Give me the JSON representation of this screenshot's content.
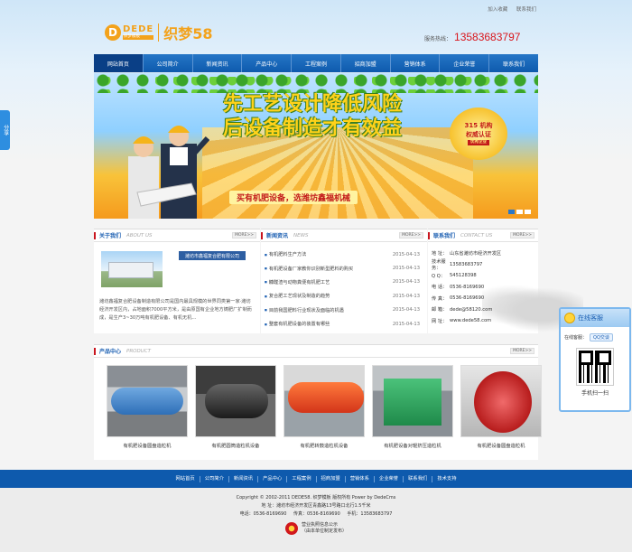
{
  "top_links": [
    "加入收藏",
    "联系我们"
  ],
  "logo": {
    "letter": "D",
    "dede": "DEDE",
    "dede_sub": "织梦模板",
    "text": "织梦58"
  },
  "hotline": {
    "label": "服务热线：",
    "number": "13583683797"
  },
  "nav": [
    {
      "label": "网站首页",
      "active": true
    },
    {
      "label": "公司简介"
    },
    {
      "label": "新闻资讯"
    },
    {
      "label": "产品中心"
    },
    {
      "label": "工程案例"
    },
    {
      "label": "招商加盟"
    },
    {
      "label": "营销体系"
    },
    {
      "label": "企业荣誉"
    },
    {
      "label": "联系我们"
    }
  ],
  "banner": {
    "line1": "先工艺设计降低风险",
    "line2": "后设备制造才有效益",
    "badge": [
      "315 机构",
      "权威认证",
      "优秀企业"
    ],
    "ribbon": "买有机肥设备，选潍坊鑫福机械"
  },
  "share": "分享",
  "about": {
    "title": "关于我们",
    "en": "ABOUT US",
    "more": "MORE>>",
    "tag": "潍坊市鑫福复合肥有限公司",
    "text": "潍坊鑫福复合肥设备制造有限公司是国内最具规模的世界同类第一家·潍坊经济开发区内，占地面积7000平方米，是由原国有企业地方铸肥厂扩制而成，是生产3~30万吨有机肥设备、有机无机..."
  },
  "news": {
    "title": "新闻资讯",
    "en": "NEWS",
    "more": "MORE>>",
    "items": [
      {
        "title": "有机肥料生产方法",
        "date": "2015-04-13"
      },
      {
        "title": "有机肥设备厂家教你识别新型肥料的购买",
        "date": "2015-04-13"
      },
      {
        "title": "糠醛渣与动物粪便有机肥工艺",
        "date": "2015-04-13"
      },
      {
        "title": "复合肥工艺现状及制造的趋势",
        "date": "2015-04-13"
      },
      {
        "title": "目前我国肥料行业现状及面临的机遇",
        "date": "2015-04-13"
      },
      {
        "title": "整套有机肥设备的装置有哪些",
        "date": "2015-04-13"
      }
    ]
  },
  "contact": {
    "title": "联系我们",
    "en": "CONTACT US",
    "more": "MORE>>",
    "rows": [
      {
        "k": "地 址：",
        "v": "山东省潍坊市经济开发区"
      },
      {
        "k": "技术服务：",
        "v": "13583683797"
      },
      {
        "k": "Q Q：",
        "v": "545128398"
      },
      {
        "k": "电 话：",
        "v": "0536-8169690"
      },
      {
        "k": "传 真：",
        "v": "0536-8169690"
      },
      {
        "k": "邮 箱：",
        "v": "dede@58120.com"
      },
      {
        "k": "网 址：",
        "v": "www.dede58.com"
      }
    ]
  },
  "kefu": {
    "title": "在线客服",
    "label": "在线客服：",
    "qq": "QQ交谈",
    "scan": "手机扫一扫"
  },
  "products": {
    "title": "产品中心",
    "en": "PRODUCT",
    "more": "MORE>>",
    "items": [
      {
        "caption": "有机肥设备圆盘造粒机"
      },
      {
        "caption": "有机肥圆筒造粒机设备"
      },
      {
        "caption": "有机肥转鼓造粒机设备"
      },
      {
        "caption": "有机肥设备对辊挤压造粒机"
      },
      {
        "caption": "有机肥设备圆盘造粒机"
      }
    ]
  },
  "footer_nav": [
    "网站首页",
    "公司简介",
    "新闻资讯",
    "产品中心",
    "工程案例",
    "招商加盟",
    "营销体系",
    "企业荣誉",
    "联系我们",
    "技术支持"
  ],
  "footer": {
    "copyright": "Copyright © 2002-2011 DEDE58. 织梦模板 版权所有 Power by DedeCms",
    "address": "地 址：潍坊市经济开发区青鑫路13号路口北行1.5千米",
    "tel": "电话：0536-8169690",
    "fax": "传真：0536-8169690",
    "mobile": "手机：13583683797",
    "license1": "营业执照信息公示",
    "license2": "（由本单位制定发布）"
  }
}
